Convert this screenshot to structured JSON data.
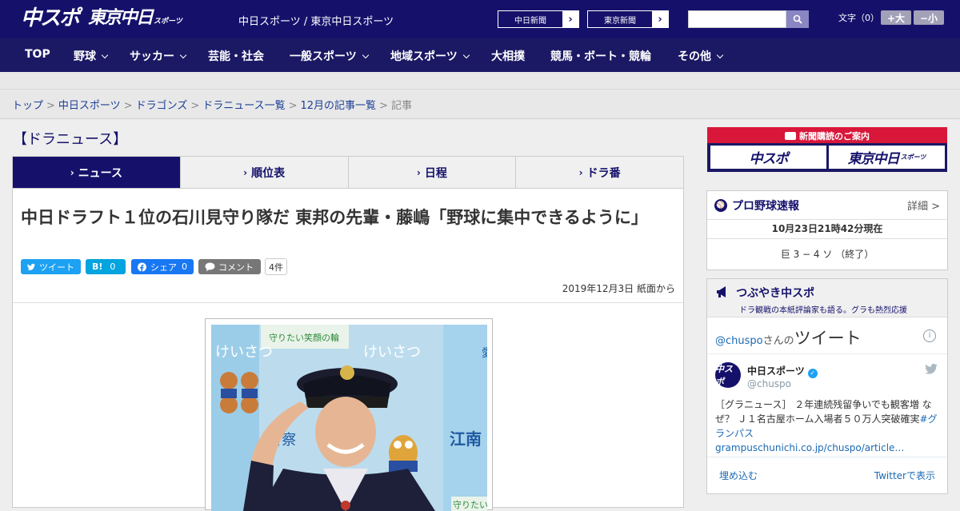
{
  "header": {
    "logo_chuspo": "中スポ",
    "logo_tokyo": "東京中日",
    "logo_tokyo_sub": "スポーツ",
    "site_title": "中日スポーツ / 東京中日スポーツ",
    "sites": [
      "中日新聞",
      "東京新聞"
    ],
    "search_placeholder": "",
    "font_label": "文字（0）",
    "font_larger": "+大",
    "font_smaller": "−小"
  },
  "nav": {
    "items": [
      {
        "label": "TOP",
        "dropdown": false
      },
      {
        "label": "野球",
        "dropdown": true
      },
      {
        "label": "サッカー",
        "dropdown": true
      },
      {
        "label": "芸能・社会",
        "dropdown": false
      },
      {
        "label": "一般スポーツ",
        "dropdown": true
      },
      {
        "label": "地域スポーツ",
        "dropdown": true
      },
      {
        "label": "大相撲",
        "dropdown": false
      },
      {
        "label": "競馬・ボート・競輪",
        "dropdown": false
      },
      {
        "label": "その他",
        "dropdown": true
      }
    ]
  },
  "breadcrumb": {
    "links": [
      "トップ",
      "中日スポーツ",
      "ドラゴンズ",
      "ドラニュース一覧",
      "12月の記事一覧"
    ],
    "current": "記事"
  },
  "section": {
    "title": "【ドラニュース】"
  },
  "tabs": [
    {
      "label": "ニュース",
      "active": true
    },
    {
      "label": "順位表",
      "active": false
    },
    {
      "label": "日程",
      "active": false
    },
    {
      "label": "ドラ番",
      "active": false
    }
  ],
  "article": {
    "headline": "中日ドラフト１位の石川見守り隊だ 東邦の先輩・藤嶋「野球に集中できるように」",
    "share": {
      "tweet": "ツイート",
      "hatena_count": "0",
      "fb_label": "シェア",
      "fb_count": "0",
      "comment": "コメント",
      "comment_count": "4件"
    },
    "date": "2019年12月3日 紙面から"
  },
  "photo": {
    "banner_left": "守りたい笑顔の輪",
    "banner_right": "守りたい",
    "wall_text_1": "けいさつ",
    "wall_text_2": "江南",
    "wall_text_3": "愛",
    "wall_text_4": "警察"
  },
  "subscribe": {
    "label": "新聞購読のご案内",
    "buttons": [
      "中スポ",
      "東京中日"
    ],
    "sub": "スポーツ"
  },
  "scoreboard": {
    "title": "プロ野球速報",
    "detail": "詳細 >",
    "time": "10月23日21時42分現在",
    "line": "巨 3 − 4 ソ （終了）"
  },
  "tweets": {
    "title": "つぶやき中スポ",
    "subtitle": "ドラ観戦の本紙評論家も語る。グラも熱烈応援",
    "handle": "@chuspo",
    "handle_suffix": "さんの",
    "heading": "ツイート",
    "info": "i",
    "author_name": "中日スポーツ",
    "author_user": "@chuspo",
    "avatar": "中スポ",
    "text": "［グラニュース］ ２年連続残留争いでも観客増 なぜ？ Ｊ１名古屋ホーム入場者５０万人突破確実",
    "hashtag": "#グランパス",
    "link": "grampuschunichi.co.jp/chuspo/article…",
    "embed": "埋め込む",
    "view": "Twitterで表示"
  },
  "colors": {
    "brand_navy": "#15116b",
    "accent_red": "#d8173a",
    "twitter_blue": "#1da1f2",
    "fb_blue": "#1877f2",
    "hatena_blue": "#00a4de"
  }
}
